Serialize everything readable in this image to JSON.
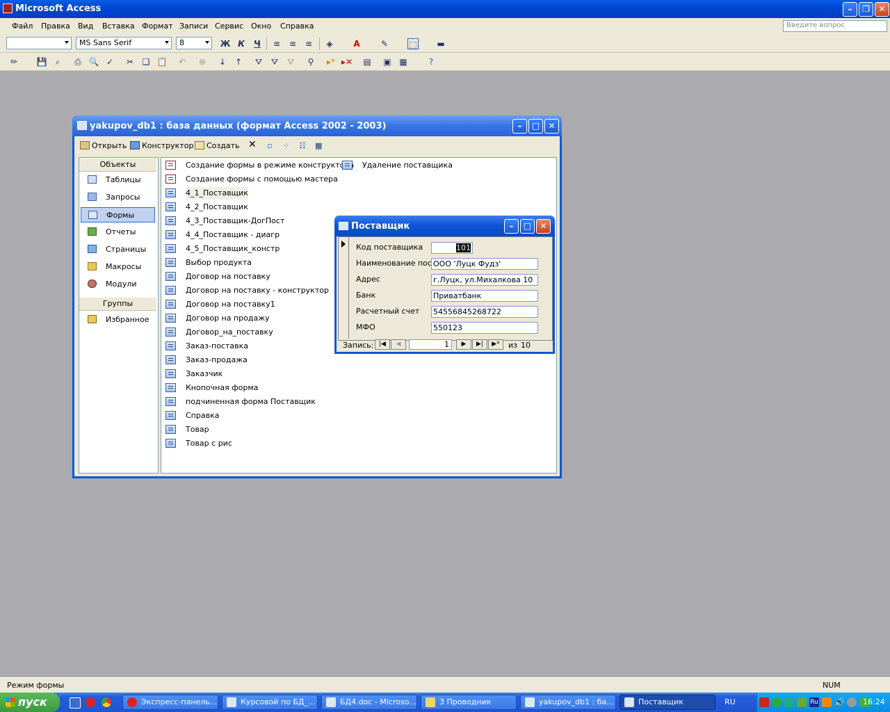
{
  "app": {
    "title": "Microsoft Access"
  },
  "menu": {
    "items": [
      "Файл",
      "Правка",
      "Вид",
      "Вставка",
      "Формат",
      "Записи",
      "Сервис",
      "Окно",
      "Справка"
    ],
    "ask_placeholder": "Введите вопрос"
  },
  "toolbar": {
    "font_name": "MS Sans Serif",
    "font_size": "8",
    "bold": "Ж",
    "italic": "К",
    "underline": "Ч"
  },
  "db_window": {
    "title": "yakupov_db1 : база данных (формат Access 2002 - 2003)",
    "open_label": "Открыть",
    "design_label": "Конструктор",
    "create_label": "Создать",
    "objects_header": "Объекты",
    "objects": [
      "Таблицы",
      "Запросы",
      "Формы",
      "Отчеты",
      "Страницы",
      "Макросы",
      "Модули"
    ],
    "groups_header": "Группы",
    "favorites": "Избранное",
    "forms_col1": [
      "Создание формы в режиме конструктора",
      "Создание формы с помощью мастера",
      "4_1_Поставщик",
      "4_2_Поставщик",
      "4_3_Поставщик-ДогПост",
      "4_4_Поставщик - диагр",
      "4_5_Поставщик_констр",
      "Выбор продукта",
      "Договор на поставку",
      "Договор на поставку - конструктор",
      "Договор на поставку1",
      "Договор на продажу",
      "Договор_на_поставку",
      "Заказ-поставка",
      "Заказ-продажа",
      "Заказчик",
      "Кнопочная форма",
      "подчиненная форма Поставщик",
      "Справка",
      "Товар",
      "Товар с рис"
    ],
    "forms_col2": [
      "Удаление поставщика"
    ]
  },
  "form_window": {
    "title": "Поставщик",
    "fields": [
      {
        "label": "Код поставщика",
        "value": "101"
      },
      {
        "label": "Наименование пост",
        "value": "ООО 'Луцк Фудз'"
      },
      {
        "label": "Адрес",
        "value": "г.Луцк, ул.Михалкова 10"
      },
      {
        "label": "Банк",
        "value": "Приватбанк"
      },
      {
        "label": "Расчетный счет",
        "value": "54556845268722"
      },
      {
        "label": "МФО",
        "value": "550123"
      }
    ],
    "record_label": "Запись:",
    "record_num": "1",
    "record_of": "из",
    "record_total": "10"
  },
  "status": {
    "text": "Режим формы",
    "num": "NUM"
  },
  "taskbar": {
    "start": "пуск",
    "tasks": [
      "Экспресс-панель...",
      "Курсовой по БД_...",
      "БД4.doc - Microso...",
      "3 Проводник",
      "yakupov_db1 : ба...",
      "Поставщик"
    ],
    "lang": "RU",
    "time": "16:24"
  }
}
